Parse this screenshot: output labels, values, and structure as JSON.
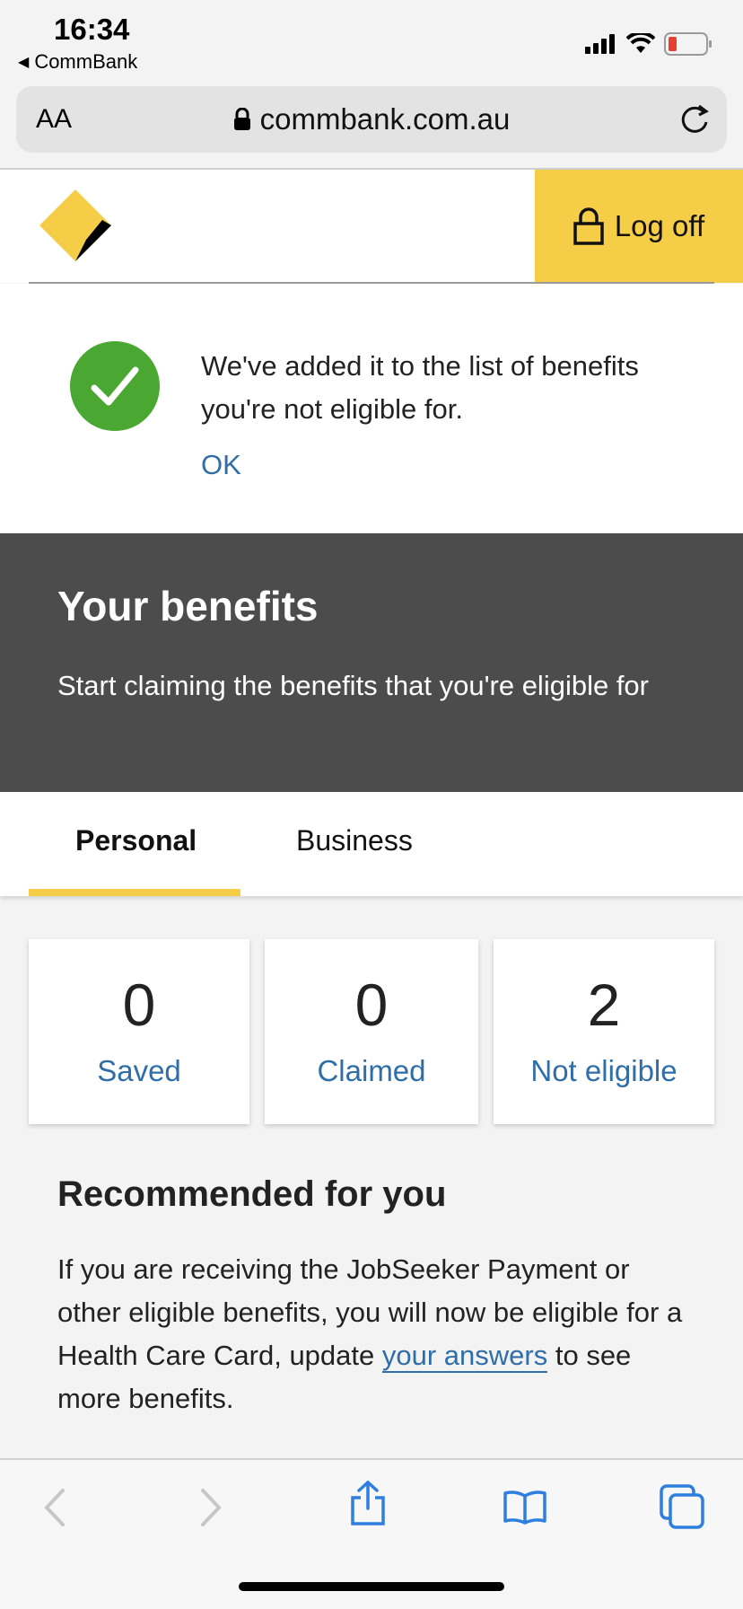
{
  "status": {
    "time": "16:34",
    "back_app": "CommBank"
  },
  "browser": {
    "text_size_label": "AA",
    "url": "commbank.com.au"
  },
  "header": {
    "logoff_label": "Log off"
  },
  "notification": {
    "message": "We've added it to the list of benefits you're not eligible for.",
    "ok_label": "OK"
  },
  "hero": {
    "title": "Your benefits",
    "subtitle": "Start claiming the benefits that you're eligible for"
  },
  "tabs": [
    {
      "label": "Personal",
      "active": true
    },
    {
      "label": "Business",
      "active": false
    }
  ],
  "stats": [
    {
      "value": "0",
      "label": "Saved"
    },
    {
      "value": "0",
      "label": "Claimed"
    },
    {
      "value": "2",
      "label": "Not eligible"
    }
  ],
  "recommended": {
    "title": "Recommended for you",
    "text_before": "If you are receiving the JobSeeker Payment or other eligible benefits, you will now be eligible for a Health Care Card, update ",
    "link": "your answers",
    "text_after": " to see more benefits."
  },
  "colors": {
    "brand_yellow": "#f6cd46",
    "success_green": "#4aa832",
    "link_blue": "#2f6ea8",
    "hero_bg": "#4d4c4d"
  }
}
